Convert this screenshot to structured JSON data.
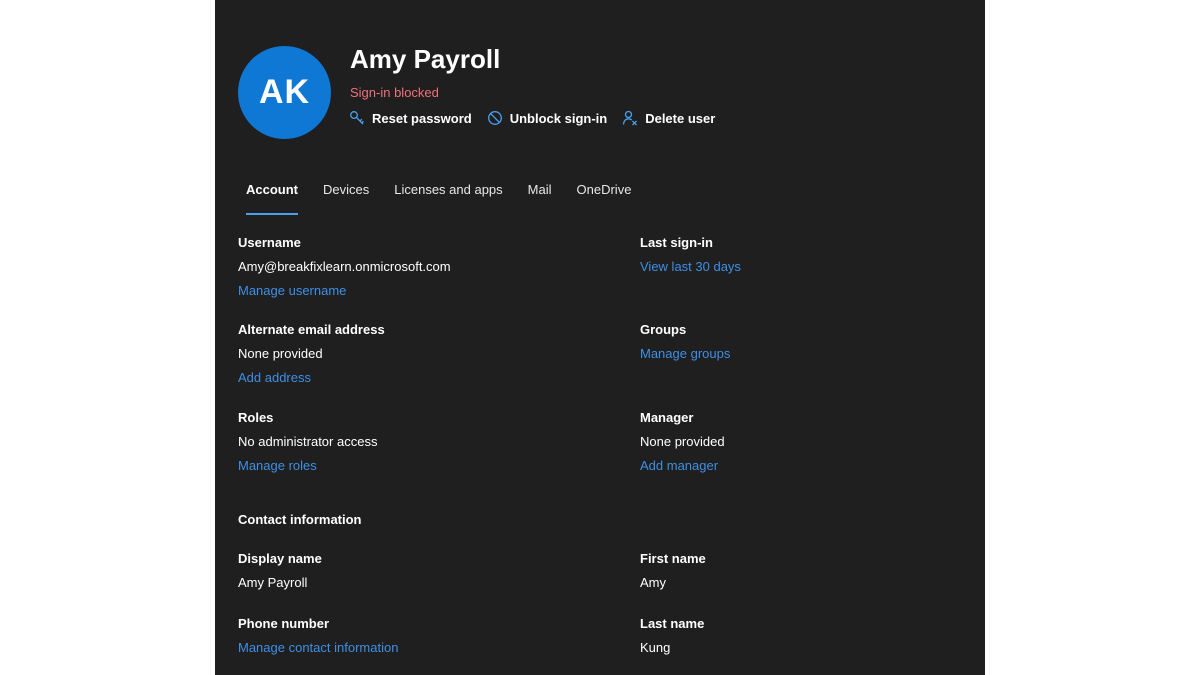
{
  "user": {
    "initials": "AK",
    "name": "Amy Payroll",
    "status": "Sign-in blocked"
  },
  "actions": [
    {
      "label": "Reset password",
      "icon": "key-icon"
    },
    {
      "label": "Unblock sign-in",
      "icon": "block-icon"
    },
    {
      "label": "Delete user",
      "icon": "person-remove-icon"
    }
  ],
  "tabs": [
    "Account",
    "Devices",
    "Licenses and apps",
    "Mail",
    "OneDrive"
  ],
  "active_tab": "Account",
  "account": {
    "username": {
      "label": "Username",
      "value": "Amy@breakfixlearn.onmicrosoft.com",
      "link": "Manage username"
    },
    "last_signin": {
      "label": "Last sign-in",
      "link": "View last 30 days"
    },
    "alt_email": {
      "label": "Alternate email address",
      "value": "None provided",
      "link": "Add address"
    },
    "groups": {
      "label": "Groups",
      "link": "Manage groups"
    },
    "roles": {
      "label": "Roles",
      "value": "No administrator access",
      "link": "Manage roles"
    },
    "manager": {
      "label": "Manager",
      "value": "None provided",
      "link": "Add manager"
    }
  },
  "contact": {
    "title": "Contact information",
    "display_name": {
      "label": "Display name",
      "value": "Amy Payroll"
    },
    "first_name": {
      "label": "First name",
      "value": "Amy"
    },
    "phone": {
      "label": "Phone number",
      "link": "Manage contact information"
    },
    "last_name": {
      "label": "Last name",
      "value": "Kung"
    }
  },
  "colors": {
    "panel_bg": "#1f1f1f",
    "avatar": "#0f78d4",
    "status_red": "#f1707b",
    "link_blue": "#3e8fe6",
    "tab_underline": "#4aa0f0"
  }
}
